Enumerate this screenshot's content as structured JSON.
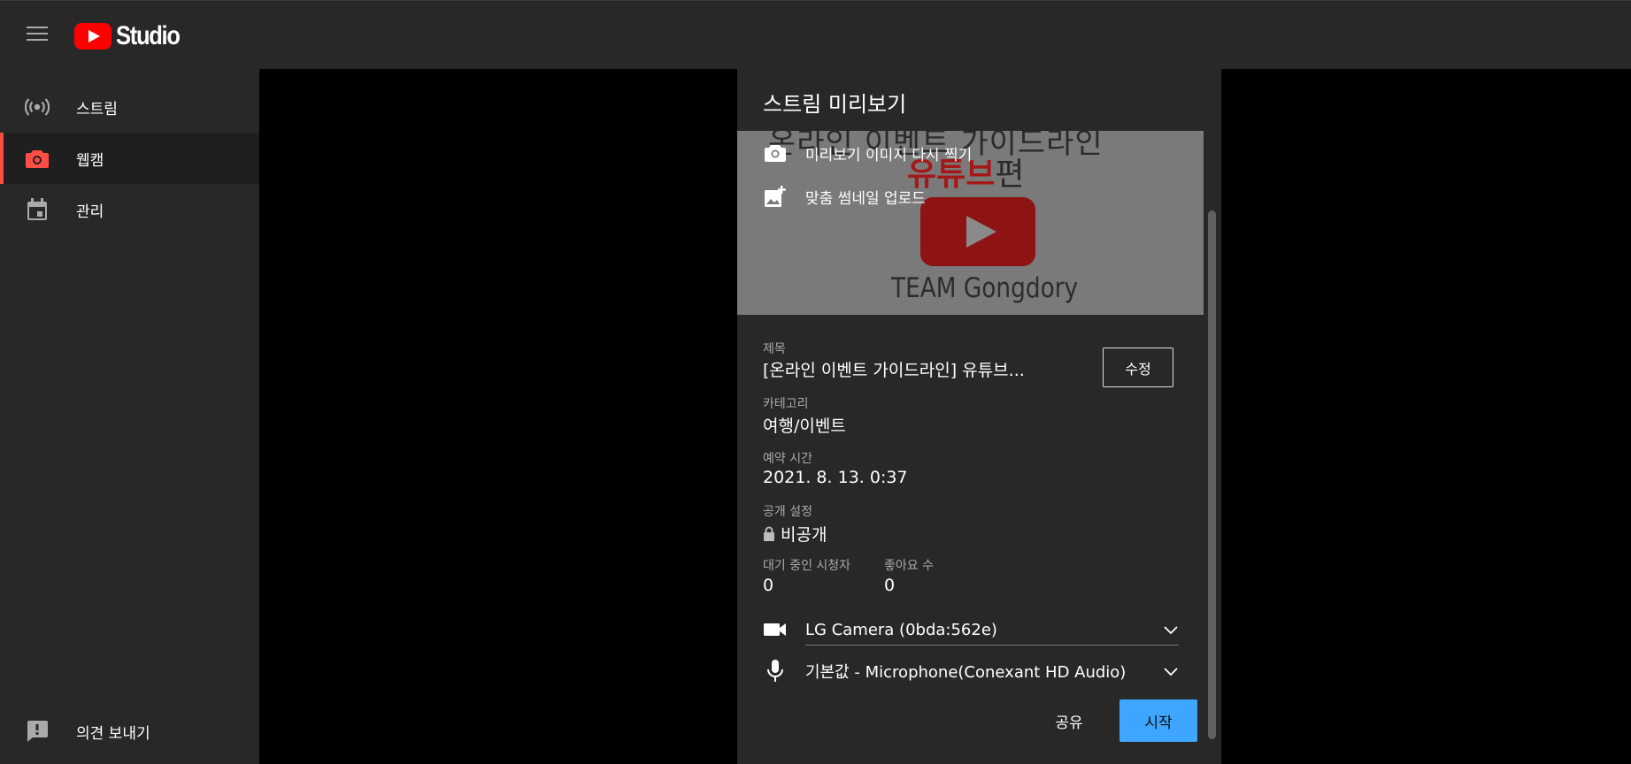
{
  "header": {
    "logo_text": "Studio"
  },
  "sidebar": {
    "items": [
      {
        "label": "스트림",
        "icon": "live-stream-icon"
      },
      {
        "label": "웹캠",
        "icon": "camera-icon",
        "active": true
      },
      {
        "label": "관리",
        "icon": "calendar-icon"
      }
    ],
    "feedback_label": "의견 보내기"
  },
  "modal": {
    "title": "스트림 미리보기",
    "preview": {
      "bg_title_partial": "온라인 이벤트 가이드라인",
      "bg_red_text": "유튜브",
      "bg_red_suffix": "편",
      "bg_team": "TEAM Gongdory",
      "retake_label": "미리보기 이미지 다시 찍기",
      "upload_label": "맞춤 썸네일 업로드"
    },
    "fields": {
      "title_label": "제목",
      "title_value": "[온라인 이벤트 가이드라인] 유튜브...",
      "edit_label": "수정",
      "category_label": "카테고리",
      "category_value": "여행/이벤트",
      "schedule_label": "예약 시간",
      "schedule_value": "2021. 8. 13. 0:37",
      "visibility_label": "공개 설정",
      "visibility_value": "비공개",
      "waiting_label": "대기 중인 시청자",
      "waiting_value": "0",
      "likes_label": "좋아요 수",
      "likes_value": "0"
    },
    "devices": {
      "camera": "LG Camera (0bda:562e)",
      "microphone": "기본값 - Microphone(Conexant HD Audio)"
    },
    "share_label": "공유",
    "start_label": "시작"
  },
  "colors": {
    "accent_red": "#ff4e45",
    "start_blue": "#3ea6ff",
    "panel_bg": "#282828"
  }
}
